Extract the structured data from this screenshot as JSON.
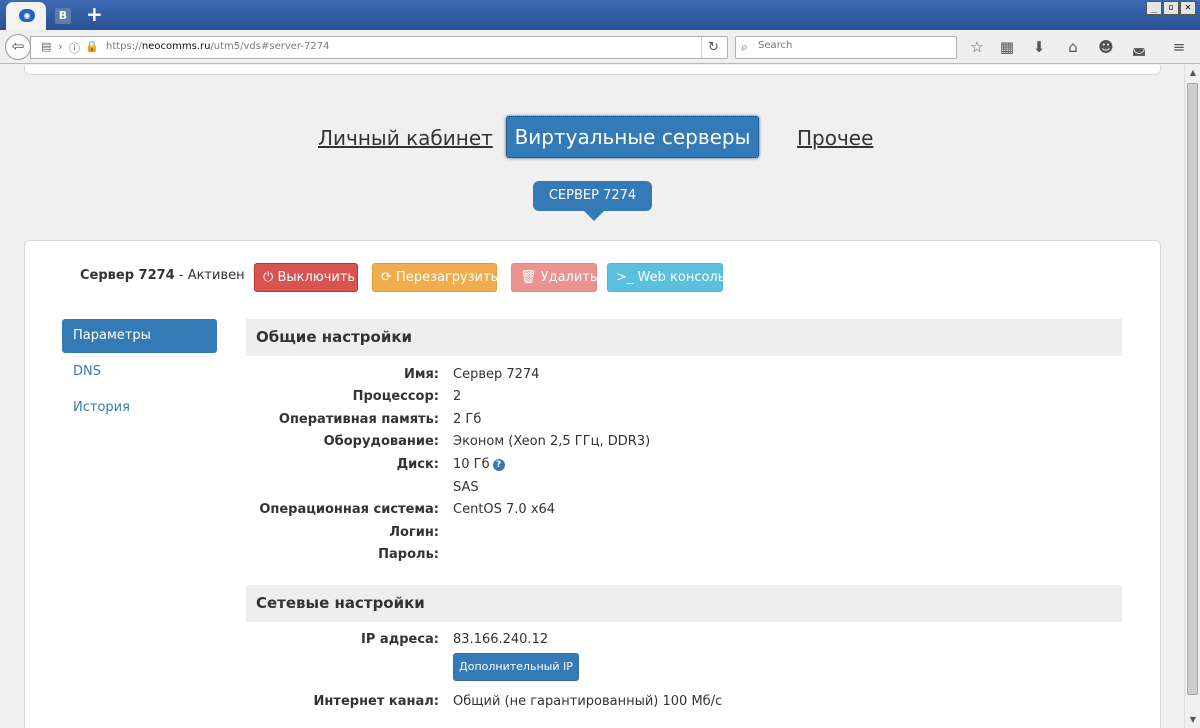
{
  "browser": {
    "tab_vk_label": "B",
    "new_tab_symbol": "+",
    "window_controls": [
      "_",
      "▫",
      "✕"
    ],
    "url_prefix": "https://",
    "url_host": "neocomms.ru",
    "url_path": "/utm5/vds#server-7274",
    "search_placeholder": "Search",
    "icons": [
      "star-icon",
      "reading-list-icon",
      "download-icon",
      "home-icon",
      "smiley-icon",
      "pocket-icon",
      "menu-icon"
    ]
  },
  "nav": {
    "cabinet": "Личный кабинет",
    "servers": "Виртуальные серверы",
    "other": "Прочее"
  },
  "server_pill": "СЕРВЕР 7274",
  "server": {
    "name": "Сервер 7274",
    "status": " - Активен"
  },
  "actions": {
    "off": "Выключить",
    "reboot": "Перезагрузить",
    "delete": "Удалить",
    "console": "Web консоль"
  },
  "sidebar": {
    "items": [
      {
        "label": "Параметры",
        "active": true
      },
      {
        "label": "DNS",
        "active": false
      },
      {
        "label": "История",
        "active": false
      }
    ]
  },
  "general": {
    "title": "Общие настройки",
    "rows": [
      {
        "label": "Имя:",
        "value": "Сервер 7274"
      },
      {
        "label": "Процессор:",
        "value": "2"
      },
      {
        "label": "Оперативная память:",
        "value": "2 Гб"
      },
      {
        "label": "Оборудование:",
        "value": "Эконом (Xeon 2,5 ГГц, DDR3)"
      },
      {
        "label": "Диск:",
        "value": "10 Гб"
      },
      {
        "label": "",
        "value": "SAS"
      },
      {
        "label": "Операционная система:",
        "value": "CentOS 7.0 x64"
      },
      {
        "label": "Логин:",
        "value": ""
      },
      {
        "label": "Пароль:",
        "value": ""
      }
    ]
  },
  "network": {
    "title": "Сетевые настройки",
    "ip_label": "IP адреса:",
    "ip_value": "83.166.240.12",
    "extra_ip_button": "Дополнительный IP",
    "channel_label": "Интернет канал:",
    "channel_value": "Общий (не гарантированный) 100 Мб/с"
  },
  "colors": {
    "primary": "#337ab7",
    "danger": "#d9534f",
    "warning": "#f0ad4e",
    "info": "#5bc0de"
  }
}
